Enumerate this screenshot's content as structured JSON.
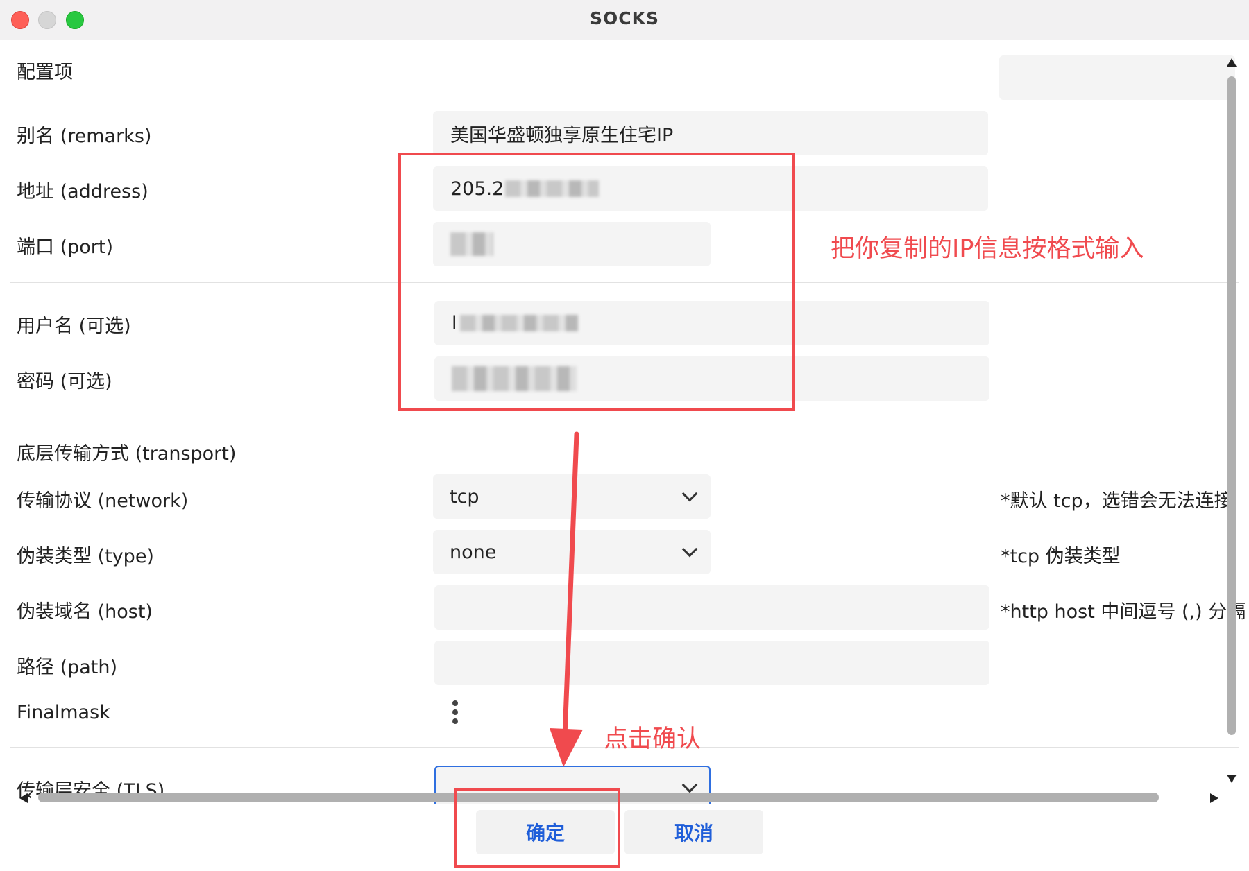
{
  "window": {
    "title": "SOCKS"
  },
  "sections": {
    "config": "配置项",
    "transport": "底层传输方式 (transport)"
  },
  "fields": {
    "remarks": {
      "label": "别名 (remarks)",
      "value": "美国华盛顿独享原生住宅IP"
    },
    "address": {
      "label": "地址 (address)",
      "value_prefix": "205.2"
    },
    "port": {
      "label": "端口 (port)"
    },
    "username": {
      "label": "用户名 (可选)",
      "value_prefix": "l"
    },
    "password": {
      "label": "密码 (可选)"
    },
    "network": {
      "label": "传输协议 (network)",
      "value": "tcp",
      "hint": "*默认 tcp，选错会无法连接"
    },
    "type": {
      "label": "伪装类型 (type)",
      "value": "none",
      "hint": "*tcp 伪装类型"
    },
    "host": {
      "label": "伪装域名 (host)",
      "hint": "*http host 中间逗号 (,) 分隔"
    },
    "path": {
      "label": "路径 (path)"
    },
    "finalmask": {
      "label": "Finalmask"
    },
    "tls": {
      "label": "传输层安全 (TLS)"
    }
  },
  "buttons": {
    "confirm": "确定",
    "cancel": "取消"
  },
  "annotations": {
    "format_hint": "把你复制的IP信息按格式输入",
    "click_confirm": "点击确认",
    "color": "#f04a4e"
  },
  "colors": {
    "accent": "#1f5ed9",
    "focus_border": "#2f6fe0"
  }
}
